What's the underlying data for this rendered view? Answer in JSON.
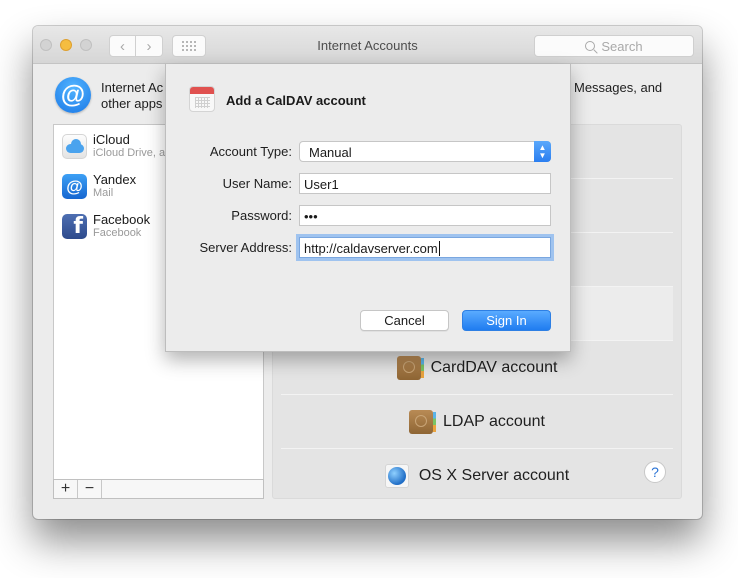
{
  "window": {
    "title": "Internet Accounts",
    "search_placeholder": "Search"
  },
  "header": {
    "line1_left": "Internet Ac",
    "line2_left": "other apps",
    "line1_right": "Messages, and"
  },
  "accounts": [
    {
      "name": "iCloud",
      "subtitle": "iCloud Drive, a",
      "icon": "icloud-icon"
    },
    {
      "name": "Yandex",
      "subtitle": "Mail",
      "icon": "at-sign-icon"
    },
    {
      "name": "Facebook",
      "subtitle": "Facebook",
      "icon": "facebook-icon"
    }
  ],
  "list_footer": {
    "add_label": "+",
    "remove_label": "−"
  },
  "providers": [
    {
      "label": "",
      "icon": ""
    },
    {
      "label": "",
      "icon": ""
    },
    {
      "label": "",
      "icon": ""
    },
    {
      "label": "",
      "icon": "",
      "selected": true
    },
    {
      "label": "CardDAV account",
      "icon": "contacts-icon"
    },
    {
      "label": "LDAP account",
      "icon": "contacts-icon"
    },
    {
      "label": "OS X Server account",
      "icon": "globe-icon"
    }
  ],
  "help_label": "?",
  "dialog": {
    "title": "Add a CalDAV account",
    "fields": {
      "account_type": {
        "label": "Account Type:",
        "value": "Manual"
      },
      "user_name": {
        "label": "User Name:",
        "value": "User1"
      },
      "password": {
        "label": "Password:",
        "value": "•••"
      },
      "server_address": {
        "label": "Server Address:",
        "value": "http://caldavserver.com"
      }
    },
    "cancel_label": "Cancel",
    "signin_label": "Sign In"
  },
  "colors": {
    "accent": "#2a7ef0",
    "traffic_minimize": "#f5bd40",
    "calendar_red": "#e0514f"
  }
}
